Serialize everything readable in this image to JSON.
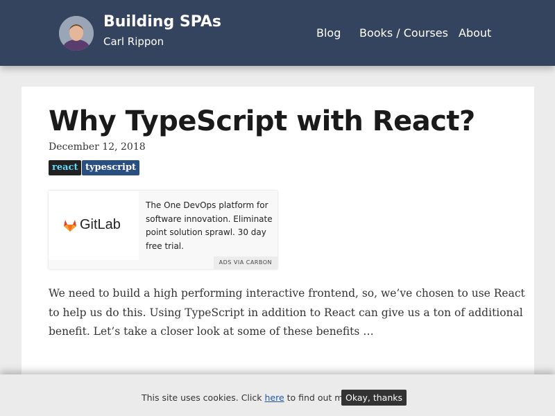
{
  "header": {
    "title": "Building SPAs",
    "subtitle": "Carl Rippon",
    "nav": [
      "Blog",
      "Books / Courses",
      "About"
    ]
  },
  "post": {
    "title": "Why TypeScript with React?",
    "date": "December 12, 2018",
    "tags": [
      "react",
      "typescript"
    ],
    "excerpt": "We need to build a high performing interactive frontend, so, we’ve chosen to use React to help us do this. Using TypeScript in addition to React can give us a ton of additional benefit. Let’s take a closer look at some of these benefits …"
  },
  "ad": {
    "brand": "GitLab",
    "text": "The One DevOps platform for software innovation. Eliminate point solution sprawl. 30 day free trial.",
    "via": "ADS VIA CARBON"
  },
  "cookie": {
    "text_before": "This site uses cookies. Click ",
    "link": "here",
    "text_after": " to find out more",
    "button": "Okay, thanks"
  },
  "colors": {
    "header_bg": "#34435e",
    "tag_react_bg": "#222222",
    "tag_react_fg": "#61dafb",
    "tag_typescript_bg": "#294e80",
    "gitlab_orange": "#e24329"
  },
  "icons": {
    "avatar": "author-avatar",
    "gitlab": "gitlab-tanuki-icon"
  }
}
